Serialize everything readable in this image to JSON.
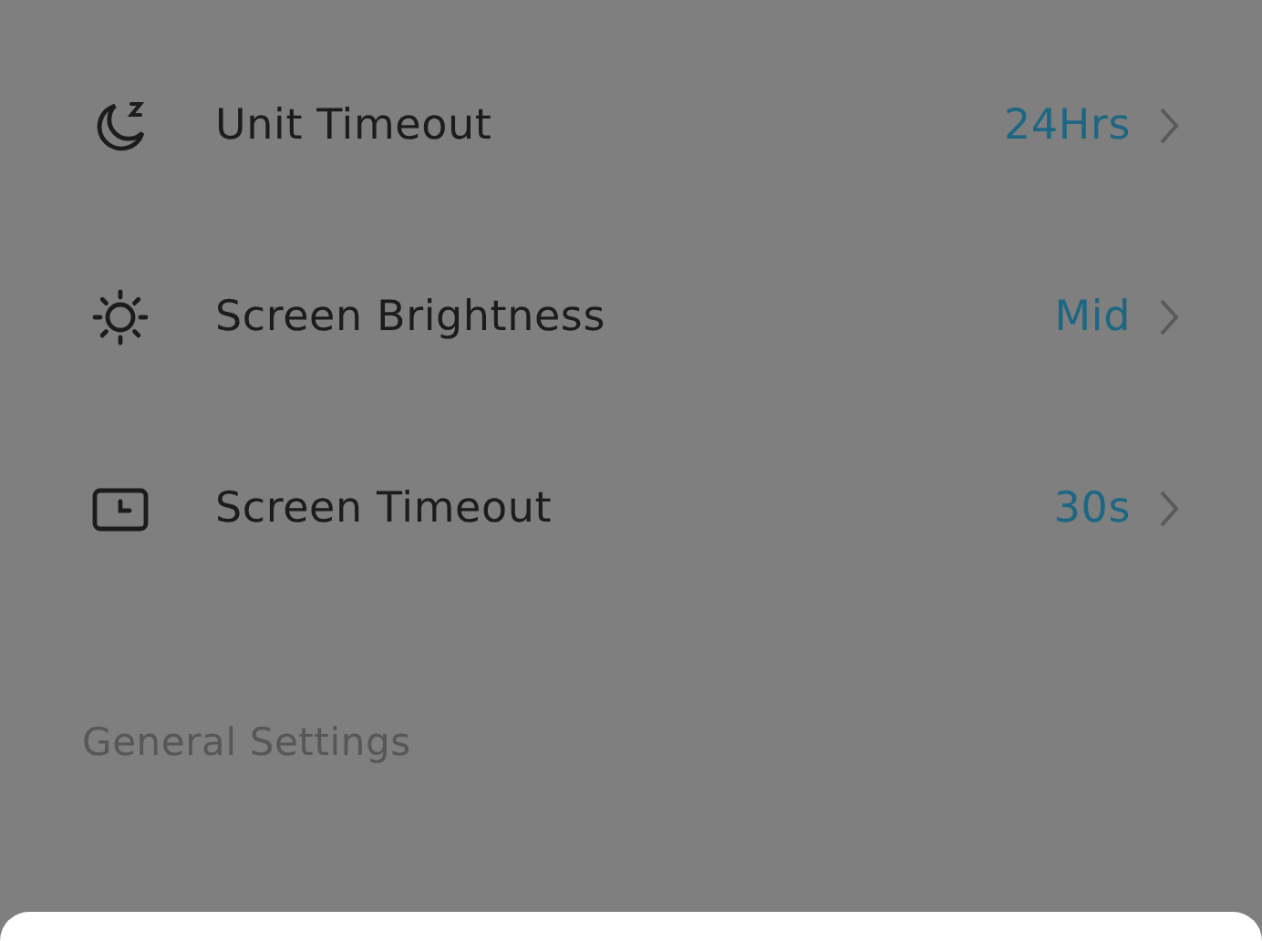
{
  "settings": [
    {
      "kind": "moon",
      "label": "Unit Timeout",
      "value": "24Hrs"
    },
    {
      "kind": "sun",
      "label": "Screen Brightness",
      "value": "Mid"
    },
    {
      "kind": "screen",
      "label": "Screen Timeout",
      "value": "30s"
    }
  ],
  "section_header": "General Settings"
}
